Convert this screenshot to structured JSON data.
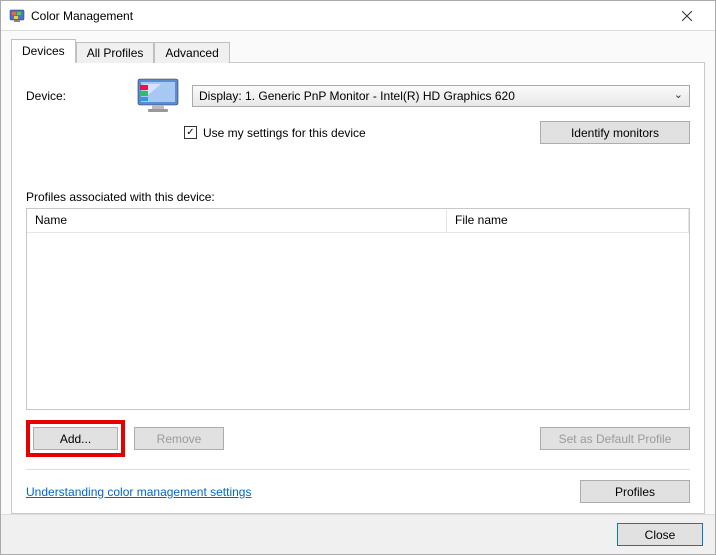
{
  "window": {
    "title": "Color Management"
  },
  "tabs": {
    "devices": "Devices",
    "all_profiles": "All Profiles",
    "advanced": "Advanced"
  },
  "device": {
    "label": "Device:",
    "selected": "Display: 1. Generic PnP Monitor - Intel(R) HD Graphics 620",
    "use_settings_label": "Use my settings for this device",
    "use_settings_checked": true,
    "identify_button": "Identify monitors"
  },
  "profiles": {
    "section_label": "Profiles associated with this device:",
    "columns": {
      "name": "Name",
      "filename": "File name"
    },
    "rows": []
  },
  "actions": {
    "add": "Add...",
    "remove": "Remove",
    "set_default": "Set as Default Profile",
    "profiles_button": "Profiles"
  },
  "link": {
    "understanding": "Understanding color management settings"
  },
  "footer": {
    "close": "Close"
  }
}
